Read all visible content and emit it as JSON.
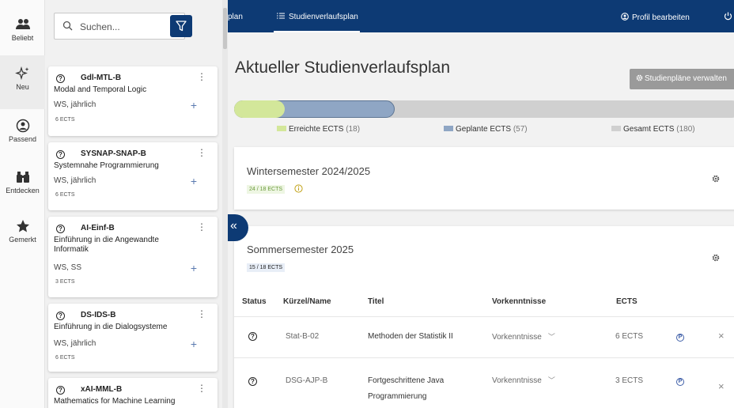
{
  "rail": [
    {
      "icon": "people-icon",
      "label": "Beliebt"
    },
    {
      "icon": "sparkle-icon",
      "label": "Neu"
    },
    {
      "icon": "person-circle-icon",
      "label": "Passend"
    },
    {
      "icon": "binoculars-icon",
      "label": "Entdecken"
    },
    {
      "icon": "star-icon",
      "label": "Gemerkt"
    }
  ],
  "search": {
    "placeholder": "Suchen...",
    "clear_glyph": "×"
  },
  "modules": [
    {
      "code": "Gdl-MTL-B",
      "title": "Modal and Temporal Logic",
      "semester": "WS, jährlich",
      "ects": "6 ECTS"
    },
    {
      "code": "SYSNAP-SNAP-B",
      "title": "Systemnahe Programmierung",
      "semester": "WS, jährlich",
      "ects": "6 ECTS"
    },
    {
      "code": "AI-Einf-B",
      "title": "Einführung in die Angewandte Informatik",
      "semester": "WS, SS",
      "ects": "3 ECTS"
    },
    {
      "code": "DS-IDS-B",
      "title": "Einführung in die Dialogsysteme",
      "semester": "WS, jährlich",
      "ects": "6 ECTS"
    },
    {
      "code": "xAI-MML-B",
      "title": "Mathematics for Machine Learning",
      "semester": "",
      "ects": ""
    }
  ],
  "topbar": {
    "prev_tab": "plan",
    "active_tab": "Studienverlaufsplan",
    "profile": "Profil bearbeiten"
  },
  "page": {
    "title": "Aktueller Studienverlaufsplan",
    "manage_button": "Studienpläne verwalten"
  },
  "progress": {
    "achieved": 18,
    "planned": 57,
    "total": 180,
    "achieved_label": "Erreichte ECTS",
    "achieved_count": "(18)",
    "planned_label": "Geplante ECTS",
    "planned_count": "(57)",
    "total_label": "Gesamt ECTS",
    "total_count": "(180)",
    "colors": {
      "achieved": "#d3e79a",
      "planned": "#8fa6c4",
      "total": "#d0d0d0"
    }
  },
  "semesters": [
    {
      "title": "Wintersemester 2024/2025",
      "badge": "24 / 18 ECTS"
    },
    {
      "title": "Sommersemester 2025",
      "badge": "15 / 18 ECTS"
    }
  ],
  "table": {
    "headers": {
      "status": "Status",
      "code": "Kürzel/Name",
      "title": "Titel",
      "prereq": "Vorkenntnisse",
      "ects": "ECTS"
    },
    "rows": [
      {
        "code": "Stat-B-02",
        "title_line1": "Methoden der Statistik II",
        "title_line2": "",
        "prereq": "Vorkenntnisse",
        "ects": "6 ECTS"
      },
      {
        "code": "DSG-AJP-B",
        "title_line1": "Fortgeschrittene Java",
        "title_line2": "Programmierung",
        "prereq": "Vorkenntnisse",
        "ects": "3 ECTS"
      }
    ]
  },
  "colors": {
    "brand": "#0d3a74",
    "accent_green": "#6a9a3b"
  }
}
